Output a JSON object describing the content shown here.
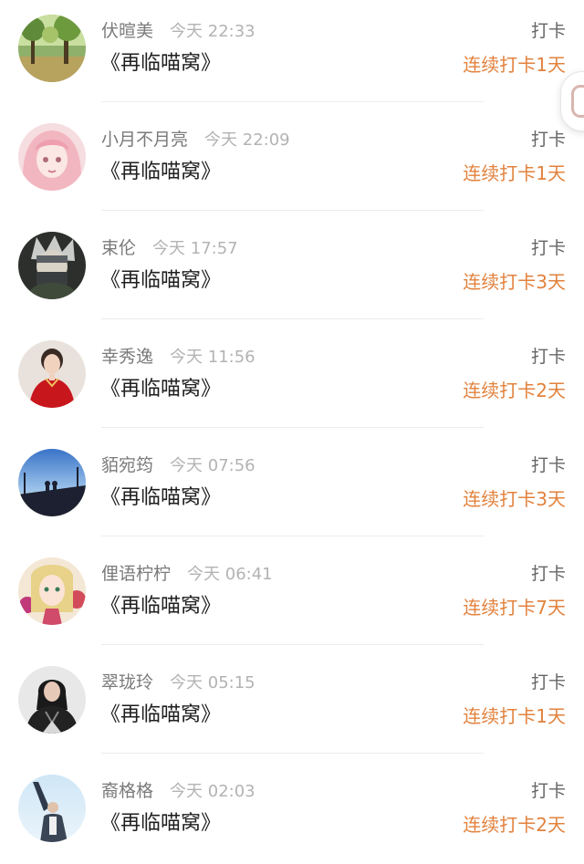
{
  "checkins": [
    {
      "name": "伏暄美",
      "time": "今天 22:33",
      "title": "《再临喵窝》",
      "action": "打卡",
      "streak": "连续打卡1天",
      "avatar": "park-trees-avatar"
    },
    {
      "name": "小月不月亮",
      "time": "今天 22:09",
      "title": "《再临喵窝》",
      "action": "打卡",
      "streak": "连续打卡1天",
      "avatar": "anime-pink-girl-avatar"
    },
    {
      "name": "束伦",
      "time": "今天 17:57",
      "title": "《再临喵窝》",
      "action": "打卡",
      "streak": "连续打卡3天",
      "avatar": "masked-ninja-avatar"
    },
    {
      "name": "幸秀逸",
      "time": "今天 11:56",
      "title": "《再临喵窝》",
      "action": "打卡",
      "streak": "连续打卡2天",
      "avatar": "red-qipao-woman-avatar"
    },
    {
      "name": "貊宛筠",
      "time": "今天 07:56",
      "title": "《再临喵窝》",
      "action": "打卡",
      "streak": "连续打卡3天",
      "avatar": "couple-on-bridge-avatar"
    },
    {
      "name": "俚语柠柠",
      "time": "今天 06:41",
      "title": "《再临喵窝》",
      "action": "打卡",
      "streak": "连续打卡7天",
      "avatar": "anime-flower-girl-avatar"
    },
    {
      "name": "翠珑玲",
      "time": "今天 05:15",
      "title": "《再临喵窝》",
      "action": "打卡",
      "streak": "连续打卡1天",
      "avatar": "leather-jacket-woman-avatar"
    },
    {
      "name": "裔格格",
      "time": "今天 02:03",
      "title": "《再临喵窝》",
      "action": "打卡",
      "streak": "连续打卡2天",
      "avatar": "man-waving-avatar"
    }
  ],
  "floating_button": {
    "icon": "paw-icon"
  },
  "colors": {
    "streak": "#e2823d",
    "name": "#7a7a7a",
    "time": "#b3b3b3",
    "title": "#1e1e1e"
  }
}
